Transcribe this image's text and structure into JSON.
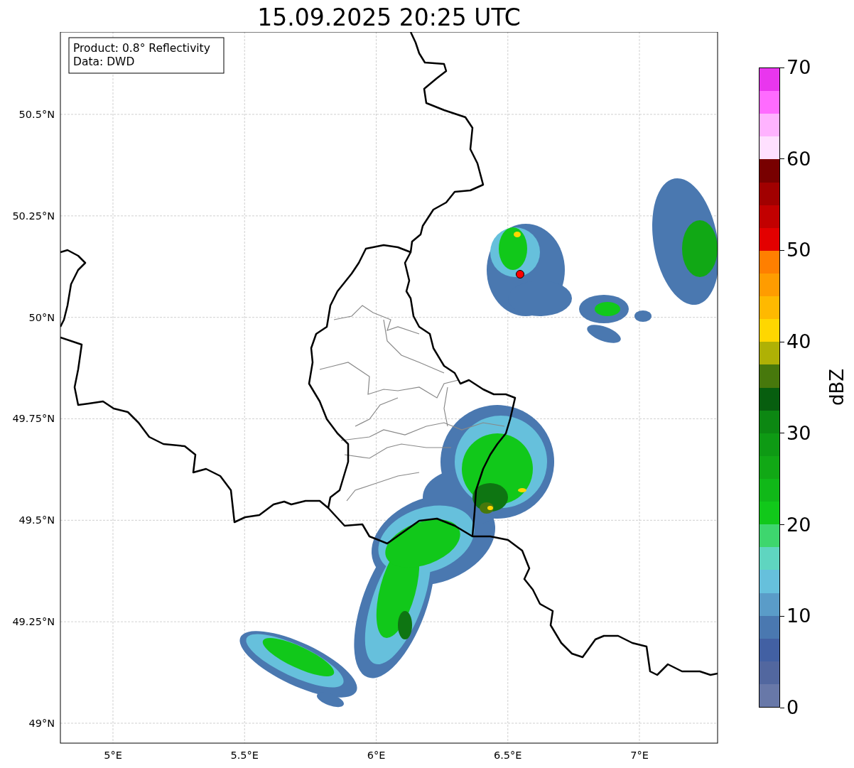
{
  "title": "15.09.2025 20:25 UTC",
  "info_box": {
    "lines": [
      "Product: 0.8° Reflectivity",
      "Data: DWD"
    ]
  },
  "map": {
    "lat_ticks": [
      "50.5°N",
      "50.25°N",
      "50°N",
      "49.75°N",
      "49.5°N",
      "49.25°N",
      "49°N"
    ],
    "lon_ticks": [
      "5°E",
      "5.5°E",
      "6°E",
      "6.5°E",
      "7°E"
    ]
  },
  "colorbar": {
    "label": "dBZ",
    "ticks": [
      "70",
      "60",
      "50",
      "40",
      "30",
      "20",
      "10",
      "0"
    ],
    "segments": [
      {
        "color": "#e936ee"
      },
      {
        "color": "#ff6bff"
      },
      {
        "color": "#ffb3ff"
      },
      {
        "color": "#ffe0ff"
      },
      {
        "color": "#780000"
      },
      {
        "color": "#a10000"
      },
      {
        "color": "#c20000"
      },
      {
        "color": "#e30000"
      },
      {
        "color": "#ff7f00"
      },
      {
        "color": "#ff9c00"
      },
      {
        "color": "#ffb900"
      },
      {
        "color": "#ffd700"
      },
      {
        "color": "#afb105"
      },
      {
        "color": "#47780c"
      },
      {
        "color": "#075e0f"
      },
      {
        "color": "#0c8712"
      },
      {
        "color": "#0e9a14"
      },
      {
        "color": "#11a815"
      },
      {
        "color": "#10b818"
      },
      {
        "color": "#11c81a"
      },
      {
        "color": "#3ed66e"
      },
      {
        "color": "#5fd5c0"
      },
      {
        "color": "#66c0dc"
      },
      {
        "color": "#5a9cc8"
      },
      {
        "color": "#4a78b0"
      },
      {
        "color": "#4260a3"
      },
      {
        "color": "#52679f"
      },
      {
        "color": "#6878a8"
      }
    ]
  }
}
